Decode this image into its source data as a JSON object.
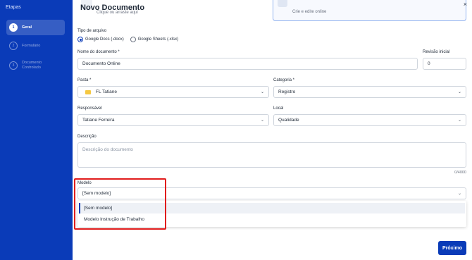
{
  "sidebar": {
    "title": "Etapas",
    "steps": [
      {
        "number": "1",
        "label": "Geral"
      },
      {
        "number": "2",
        "label": "Formulário"
      },
      {
        "number": "3",
        "label": "Documento Controlado"
      }
    ]
  },
  "dialog": {
    "title": "Novo Documento",
    "close": "×",
    "upload_hint": "Clique ou arraste aqui",
    "online_hint": "Crie e edite online"
  },
  "form": {
    "file_type_label": "Tipo de arquivo",
    "file_type_options": [
      "Google Docs (.docx)",
      "Google Sheets (.xlsx)"
    ],
    "doc_name_label": "Nome do documento *",
    "doc_name_value": "Documento Online",
    "revision_label": "Revisão inicial",
    "revision_value": "0",
    "folder_label": "Pasta *",
    "folder_value": "FL Tatiane",
    "category_label": "Categoria *",
    "category_value": "Registro",
    "responsible_label": "Responsável",
    "responsible_value": "Tatiane Ferreira",
    "local_label": "Local",
    "local_value": "Qualidade",
    "description_label": "Descrição",
    "description_placeholder": "Descrição do documento",
    "description_counter": "0/4000",
    "model_label": "Modelo",
    "model_value": "[Sem modelo]",
    "model_options": [
      "[Sem modelo]",
      "Modelo Instrução de Trabalho"
    ]
  },
  "footer": {
    "next_label": "Próximo"
  },
  "colors": {
    "sidebar_bg": "#0a3bb8",
    "primary": "#0a3bb8",
    "highlight": "#e11d1d"
  },
  "icons": {
    "close": "close-icon",
    "folder": "folder-icon",
    "chevron": "chevron-down-icon"
  }
}
